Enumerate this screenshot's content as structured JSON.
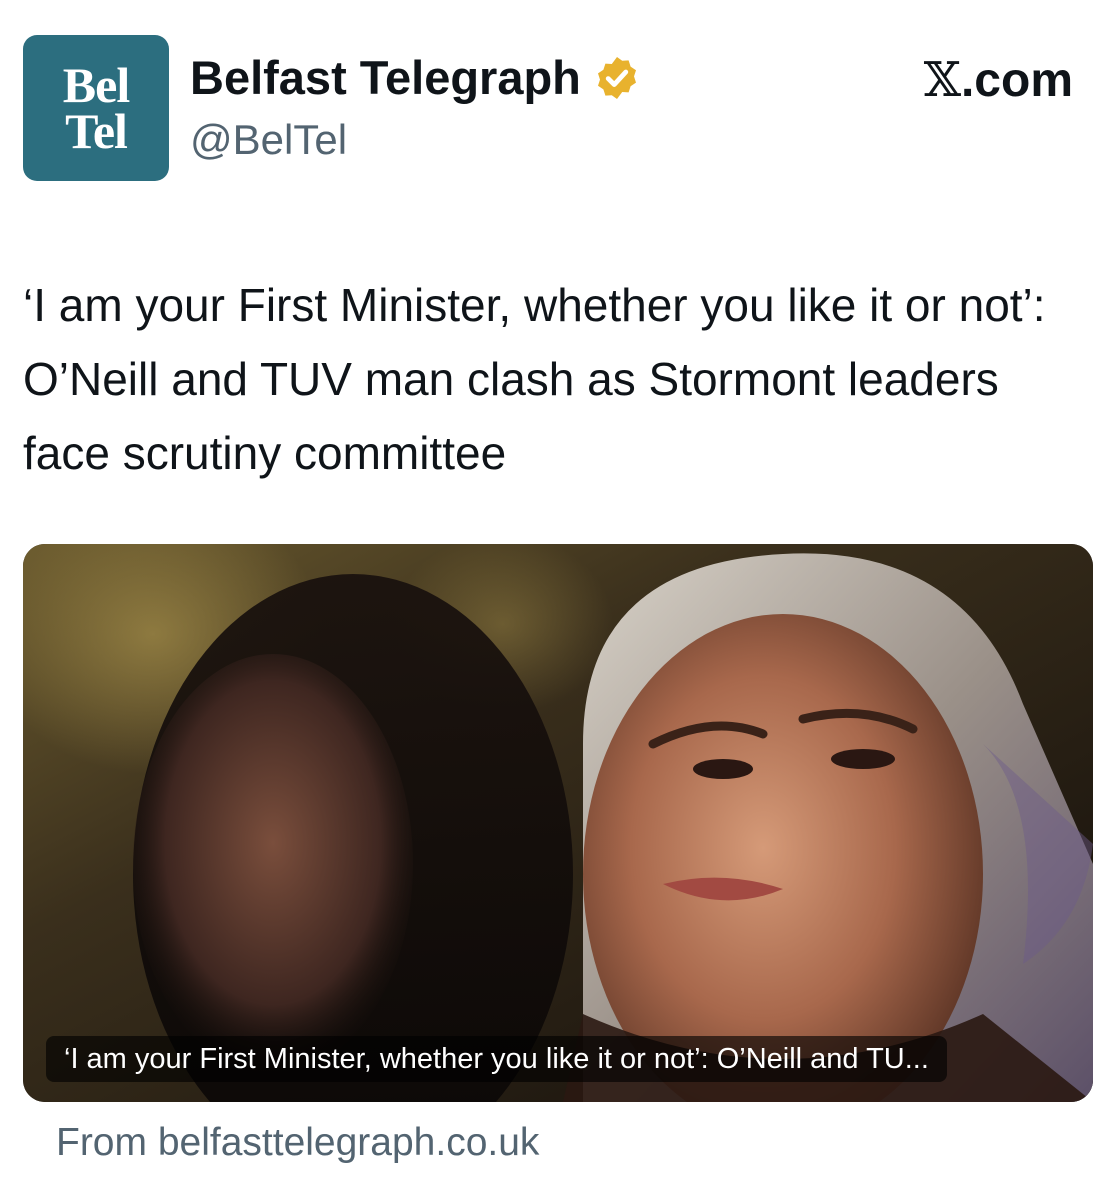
{
  "account": {
    "avatar_line1": "Bel",
    "avatar_line2": "Tel",
    "display_name": "Belfast Telegraph",
    "handle": "@BelTel",
    "verified_badge_icon": "verified-badge-icon",
    "badge_color": "#e8b22e"
  },
  "source_mark": {
    "x_letter": "𝕏",
    "domain_suffix": ".com"
  },
  "tweet": {
    "text": "‘I am your First Minister, whether you like it or not’: O’Neill and TUV man clash as Stormont leaders face scrutiny committee"
  },
  "link_card": {
    "caption": "‘I am your First Minister, whether you like it or not’: O’Neill and TU...",
    "source": "From belfasttelegraph.co.uk",
    "image_icon": "news-photo-image"
  },
  "colors": {
    "avatar_bg": "#2c6e7f",
    "text_primary": "#0f1419",
    "text_secondary": "#536471"
  }
}
